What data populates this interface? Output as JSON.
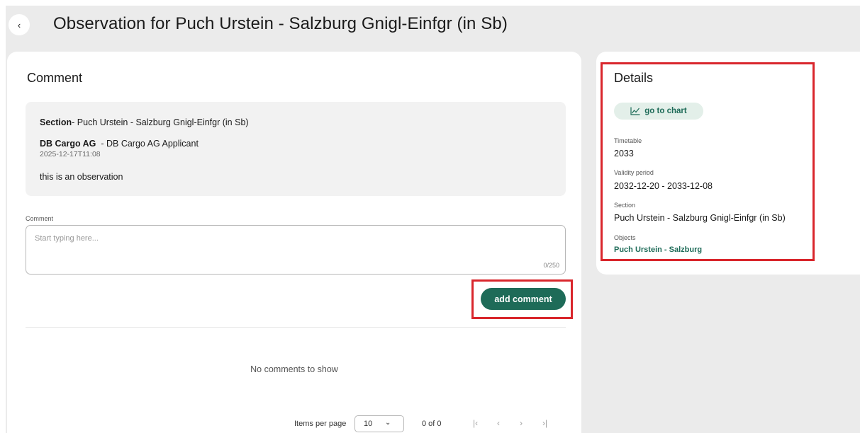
{
  "header": {
    "back_icon": "chevron-left-icon",
    "title": "Observation for Puch Urstein - Salzburg Gnigl-Einfgr (in Sb)"
  },
  "comment_card": {
    "heading": "Comment",
    "observation": {
      "section_label": "Section",
      "section_value": "- Puch Urstein - Salzburg Gnigl-Einfgr (in Sb)",
      "org_name": "DB Cargo AG",
      "org_role": "- DB Cargo AG Applicant",
      "timestamp": "2025-12-17T11:08",
      "text": "this is an observation"
    },
    "input": {
      "label": "Comment",
      "placeholder": "Start typing here...",
      "value": "",
      "counter": "0/250"
    },
    "add_button_label": "add comment",
    "empty_message": "No comments to show",
    "paginator": {
      "items_per_page_label": "Items per page",
      "items_per_page_value": "10",
      "range_label": "0 of 0",
      "first_icon": "first-page-icon",
      "prev_icon": "chevron-left-icon",
      "next_icon": "chevron-right-icon",
      "last_icon": "last-page-icon"
    }
  },
  "details_card": {
    "heading": "Details",
    "chart_button_label": "go to chart",
    "chart_button_icon": "line-chart-icon",
    "fields": {
      "timetable_label": "Timetable",
      "timetable_value": "2033",
      "validity_label": "Validity period",
      "validity_value": "2032-12-20 - 2033-12-08",
      "section_label": "Section",
      "section_value": "Puch Urstein - Salzburg Gnigl-Einfgr (in Sb)",
      "objects_label": "Objects",
      "objects_value": "Puch Urstein - Salzburg"
    }
  },
  "colors": {
    "accent": "#1e6b58",
    "accent_light": "#e3efe9",
    "highlight": "#d9262c",
    "background": "#ebebeb"
  }
}
